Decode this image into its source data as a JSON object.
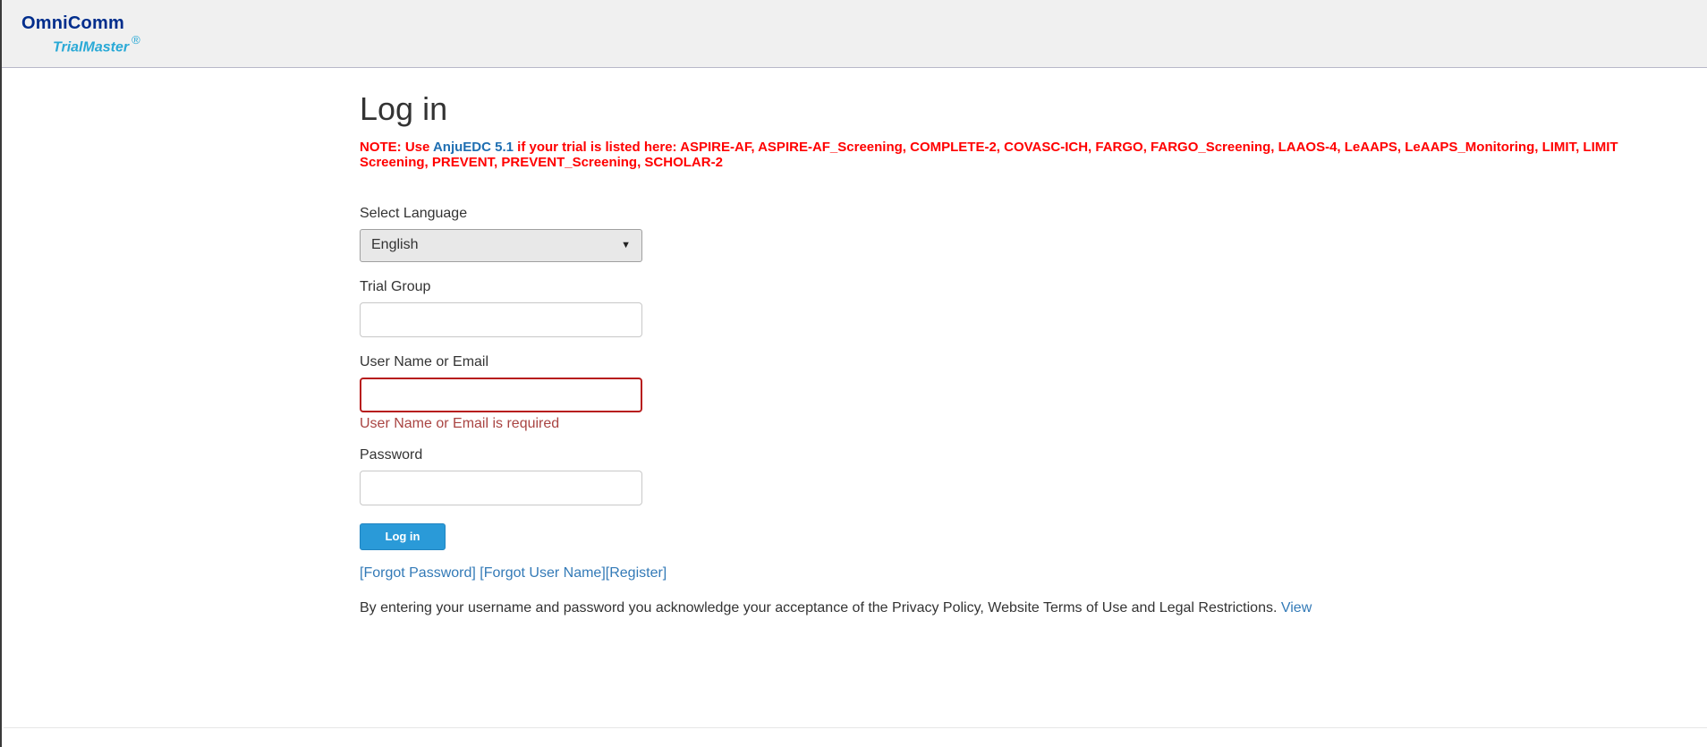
{
  "brand": {
    "name": "OmniComm",
    "product": "TrialMaster",
    "registered": "®"
  },
  "page": {
    "title": "Log in"
  },
  "note": {
    "prefix": "NOTE: Use ",
    "link_text": "AnjuEDC 5.1",
    "suffix": " if your trial is listed here: ASPIRE-AF, ASPIRE-AF_Screening, COMPLETE-2, COVASC-ICH, FARGO, FARGO_Screening, LAAOS-4, LeAAPS, LeAAPS_Monitoring, LIMIT, LIMIT Screening, PREVENT, PREVENT_Screening, SCHOLAR-2",
    "color": "#ff0000",
    "link_color": "#1f6fb2"
  },
  "form": {
    "language": {
      "label": "Select Language",
      "selected": "English"
    },
    "trial_group": {
      "label": "Trial Group",
      "value": ""
    },
    "username": {
      "label": "User Name or Email",
      "value": "",
      "error": "User Name or Email is required"
    },
    "password": {
      "label": "Password",
      "value": ""
    },
    "submit_label": "Log in"
  },
  "links": {
    "forgot_password": "[Forgot Password]",
    "forgot_username": "[Forgot User Name]",
    "register": "[Register]"
  },
  "legal": {
    "text": "By entering your username and password you acknowledge your acceptance of the Privacy Policy, Website Terms of Use and Legal Restrictions. ",
    "link": "View"
  },
  "colors": {
    "brand_primary": "#002d8c",
    "brand_accent": "#29a9d6",
    "button": "#2a9ad8",
    "error": "#a94442"
  }
}
